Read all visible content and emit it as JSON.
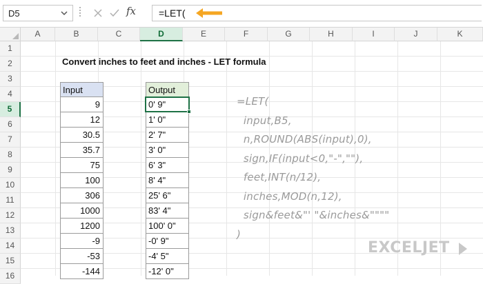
{
  "formula_bar": {
    "name_box": "D5",
    "fx_label": "fx",
    "formula": "=LET("
  },
  "columns": [
    "A",
    "B",
    "C",
    "D",
    "E",
    "F",
    "G",
    "H",
    "I",
    "J",
    "K"
  ],
  "rows": [
    "1",
    "2",
    "3",
    "4",
    "5",
    "6",
    "7",
    "8",
    "9",
    "10",
    "11",
    "12",
    "13",
    "14",
    "15",
    "16"
  ],
  "selected_column": "D",
  "selected_row": "5",
  "sheet": {
    "title": "Convert inches to feet and inches - LET formula",
    "input_header": "Input",
    "output_header": "Output",
    "inputs": [
      "9",
      "12",
      "30.5",
      "35.7",
      "75",
      "100",
      "306",
      "1000",
      "1200",
      "-9",
      "-53",
      "-144"
    ],
    "outputs": [
      "0' 9\"",
      "1' 0\"",
      "2' 7\"",
      "3' 0\"",
      "6' 3\"",
      "8' 4\"",
      "25' 6\"",
      "83' 4\"",
      "100' 0\"",
      "-0' 9\"",
      "-4' 5\"",
      "-12' 0\""
    ]
  },
  "formula_text": [
    "=LET(",
    "  input,B5,",
    "  n,ROUND(ABS(input),0),",
    "  sign,IF(input<0,\"-\",\"\"),",
    "  feet,INT(n/12),",
    "  inches,MOD(n,12),",
    "  sign&feet&\"' \"&inches&\"\"\"\"",
    ")"
  ],
  "logo_text": "EXCELJET",
  "colors": {
    "accent": "#1e7145",
    "arrow": "#f5a623",
    "input_header_bg": "#d9e1f2",
    "output_header_bg": "#e2efda"
  }
}
